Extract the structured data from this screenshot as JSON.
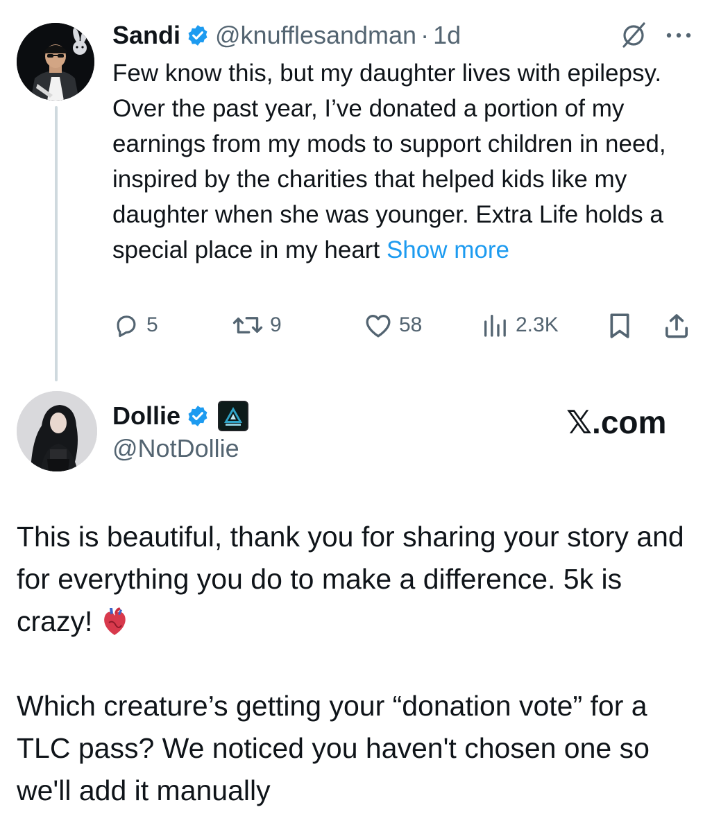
{
  "tweet1": {
    "author_name": "Sandi",
    "handle": "@knufflesandman",
    "separator": "·",
    "time": "1d",
    "text": "Few know this, but my daughter lives with epilepsy. Over the past year, I’ve donated a portion of my earnings from my mods to support children in need, inspired by the charities that helped kids like my daughter when she was younger. Extra Life holds a special place in my heart",
    "show_more": "Show more",
    "replies": "5",
    "retweets": "9",
    "likes": "58",
    "views": "2.3K"
  },
  "tweet2": {
    "author_name": "Dollie",
    "handle": "@NotDollie",
    "source": "𝕏.com",
    "paragraph1": "This is beautiful, thank you for sharing your story and for everything you do to make a difference. 5k is crazy!",
    "paragraph2": "Which creature’s getting your “donation vote” for a TLC pass? We noticed you haven't chosen one so we'll add it manually"
  },
  "icons": {
    "verified": "verified-badge-icon",
    "grok": "grok-icon",
    "more": "more-icon",
    "reply": "reply-icon",
    "retweet": "retweet-icon",
    "like": "heart-icon",
    "views": "views-icon",
    "bookmark": "bookmark-icon",
    "share": "share-icon",
    "emoji": "anatomical-heart-emoji"
  },
  "colors": {
    "text": "#0f1419",
    "secondary": "#536471",
    "link": "#1d9bf0",
    "verified": "#1d9bf0",
    "thread_line": "#cfd9de"
  }
}
